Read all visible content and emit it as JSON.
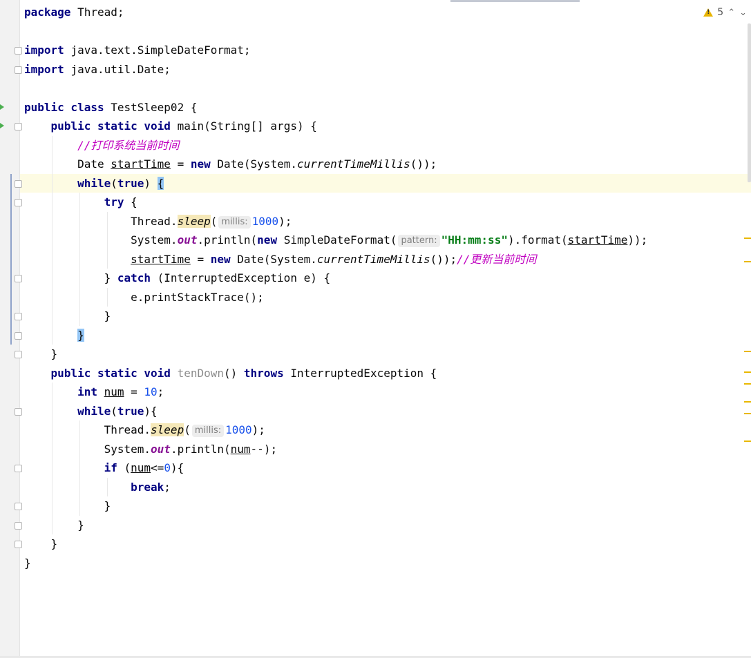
{
  "editor": {
    "lines": [
      {
        "tokens": [
          {
            "t": "package ",
            "c": "kw2"
          },
          {
            "t": "Thread;"
          }
        ]
      },
      {
        "tokens": []
      },
      {
        "tokens": [
          {
            "t": "import ",
            "c": "kw2"
          },
          {
            "t": "java.text.SimpleDateFormat;"
          }
        ]
      },
      {
        "tokens": [
          {
            "t": "import ",
            "c": "kw2"
          },
          {
            "t": "java.util.Date;"
          }
        ]
      },
      {
        "tokens": []
      },
      {
        "tokens": [
          {
            "t": "public class ",
            "c": "kw2"
          },
          {
            "t": "TestSleep02 {"
          }
        ]
      },
      {
        "tokens": [
          {
            "t": "    "
          },
          {
            "t": "public static void ",
            "c": "kw2"
          },
          {
            "t": "main(String[] args) {"
          }
        ]
      },
      {
        "tokens": [
          {
            "t": "        "
          },
          {
            "t": "//打印系统当前时间",
            "c": "cmtcn"
          }
        ]
      },
      {
        "tokens": [
          {
            "t": "        Date "
          },
          {
            "t": "startTime",
            "c": "ul"
          },
          {
            "t": " = "
          },
          {
            "t": "new ",
            "c": "kw2"
          },
          {
            "t": "Date(System."
          },
          {
            "t": "currentTimeMillis",
            "c": "sm"
          },
          {
            "t": "());"
          }
        ]
      },
      {
        "current": true,
        "tokens": [
          {
            "t": "        "
          },
          {
            "t": "while",
            "c": "kw2"
          },
          {
            "t": "("
          },
          {
            "t": "true",
            "c": "kw2"
          },
          {
            "t": ") "
          },
          {
            "t": "{",
            "c": "brace"
          }
        ]
      },
      {
        "tokens": [
          {
            "t": "            "
          },
          {
            "t": "try ",
            "c": "kw2"
          },
          {
            "t": "{"
          }
        ]
      },
      {
        "tokens": [
          {
            "t": "                Thread."
          },
          {
            "t": "sleep",
            "c": "sm hl"
          },
          {
            "t": "("
          },
          {
            "hint": "millis:"
          },
          {
            "t": "1000",
            "c": "num"
          },
          {
            "t": ");"
          }
        ]
      },
      {
        "tokens": [
          {
            "t": "                System."
          },
          {
            "t": "out",
            "c": "static"
          },
          {
            "t": ".println("
          },
          {
            "t": "new ",
            "c": "kw2"
          },
          {
            "t": "SimpleDateFormat("
          },
          {
            "hint": "pattern:"
          },
          {
            "t": "\"HH:mm:ss\"",
            "c": "str"
          },
          {
            "t": ").format("
          },
          {
            "t": "startTime",
            "c": "ul"
          },
          {
            "t": "));"
          }
        ]
      },
      {
        "tokens": [
          {
            "t": "                "
          },
          {
            "t": "startTime",
            "c": "ul"
          },
          {
            "t": " = "
          },
          {
            "t": "new ",
            "c": "kw2"
          },
          {
            "t": "Date(System."
          },
          {
            "t": "currentTimeMillis",
            "c": "sm"
          },
          {
            "t": "());"
          },
          {
            "t": "//更新当前时间",
            "c": "cmtcn"
          }
        ]
      },
      {
        "tokens": [
          {
            "t": "            } "
          },
          {
            "t": "catch ",
            "c": "kw2"
          },
          {
            "t": "(InterruptedException e) {"
          }
        ]
      },
      {
        "tokens": [
          {
            "t": "                e.printStackTrace();"
          }
        ]
      },
      {
        "tokens": [
          {
            "t": "            }"
          }
        ]
      },
      {
        "tokens": [
          {
            "t": "        "
          },
          {
            "t": "}",
            "c": "brace"
          }
        ]
      },
      {
        "tokens": [
          {
            "t": "    }"
          }
        ]
      },
      {
        "tokens": [
          {
            "t": "    "
          },
          {
            "t": "public static void ",
            "c": "kw2"
          },
          {
            "t": "tenDown",
            "c": "unused"
          },
          {
            "t": "() "
          },
          {
            "t": "throws ",
            "c": "kw2"
          },
          {
            "t": "InterruptedException {"
          }
        ]
      },
      {
        "tokens": [
          {
            "t": "        "
          },
          {
            "t": "int ",
            "c": "kw2"
          },
          {
            "t": "num",
            "c": "ul"
          },
          {
            "t": " = "
          },
          {
            "t": "10",
            "c": "num"
          },
          {
            "t": ";"
          }
        ]
      },
      {
        "tokens": [
          {
            "t": "        "
          },
          {
            "t": "while",
            "c": "kw2"
          },
          {
            "t": "("
          },
          {
            "t": "true",
            "c": "kw2"
          },
          {
            "t": "){"
          }
        ]
      },
      {
        "tokens": [
          {
            "t": "            Thread."
          },
          {
            "t": "sleep",
            "c": "sm hl"
          },
          {
            "t": "("
          },
          {
            "hint": "millis:"
          },
          {
            "t": "1000",
            "c": "num"
          },
          {
            "t": ");"
          }
        ]
      },
      {
        "tokens": [
          {
            "t": "            System."
          },
          {
            "t": "out",
            "c": "static"
          },
          {
            "t": ".println("
          },
          {
            "t": "num",
            "c": "ul"
          },
          {
            "t": "--);"
          }
        ]
      },
      {
        "tokens": [
          {
            "t": "            "
          },
          {
            "t": "if ",
            "c": "kw2"
          },
          {
            "t": "("
          },
          {
            "t": "num",
            "c": "ul"
          },
          {
            "t": "<="
          },
          {
            "t": "0",
            "c": "num"
          },
          {
            "t": "){"
          }
        ]
      },
      {
        "tokens": [
          {
            "t": "                "
          },
          {
            "t": "break",
            "c": "kw2"
          },
          {
            "t": ";"
          }
        ]
      },
      {
        "tokens": [
          {
            "t": "            }"
          }
        ]
      },
      {
        "tokens": [
          {
            "t": "        }"
          }
        ]
      },
      {
        "tokens": [
          {
            "t": "    }"
          }
        ]
      },
      {
        "tokens": [
          {
            "t": "}"
          }
        ]
      }
    ]
  },
  "status": {
    "warning_count": "5",
    "warning_icon": "warning-triangle-icon",
    "prev_icon": "chevron-up-icon",
    "next_icon": "chevron-down-icon"
  },
  "colors": {
    "keyword": "#000080",
    "string": "#067d17",
    "number": "#1750eb",
    "comment_cn": "#c000c0",
    "current_line": "#fdfbe3",
    "warning": "#e8b400"
  }
}
